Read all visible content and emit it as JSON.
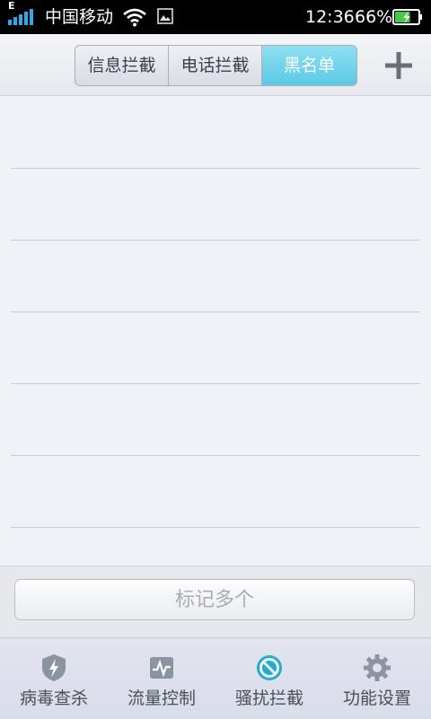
{
  "status_bar": {
    "network_type": "E",
    "carrier": "中国移动",
    "time": "12:36",
    "battery_percent": "66%",
    "battery_level": 0.66,
    "icons": [
      "signal-icon",
      "wifi-icon",
      "image-notification-icon",
      "battery-charging-icon"
    ]
  },
  "header": {
    "tabs": [
      {
        "label": "信息拦截",
        "active": false
      },
      {
        "label": "电话拦截",
        "active": false
      },
      {
        "label": "黑名单",
        "active": true
      }
    ],
    "add_icon": "plus-icon"
  },
  "list": {
    "rows": 6
  },
  "actions": {
    "mark_multiple_label": "标记多个"
  },
  "bottom_nav": {
    "items": [
      {
        "label": "病毒查杀",
        "icon": "shield-bolt-icon"
      },
      {
        "label": "流量控制",
        "icon": "traffic-chart-icon"
      },
      {
        "label": "骚扰拦截",
        "icon": "block-icon",
        "active": true
      },
      {
        "label": "功能设置",
        "icon": "gear-icon"
      }
    ]
  },
  "colors": {
    "accent": "#5cc9e6",
    "status_bar": "#000000",
    "battery": "#48c84a"
  }
}
